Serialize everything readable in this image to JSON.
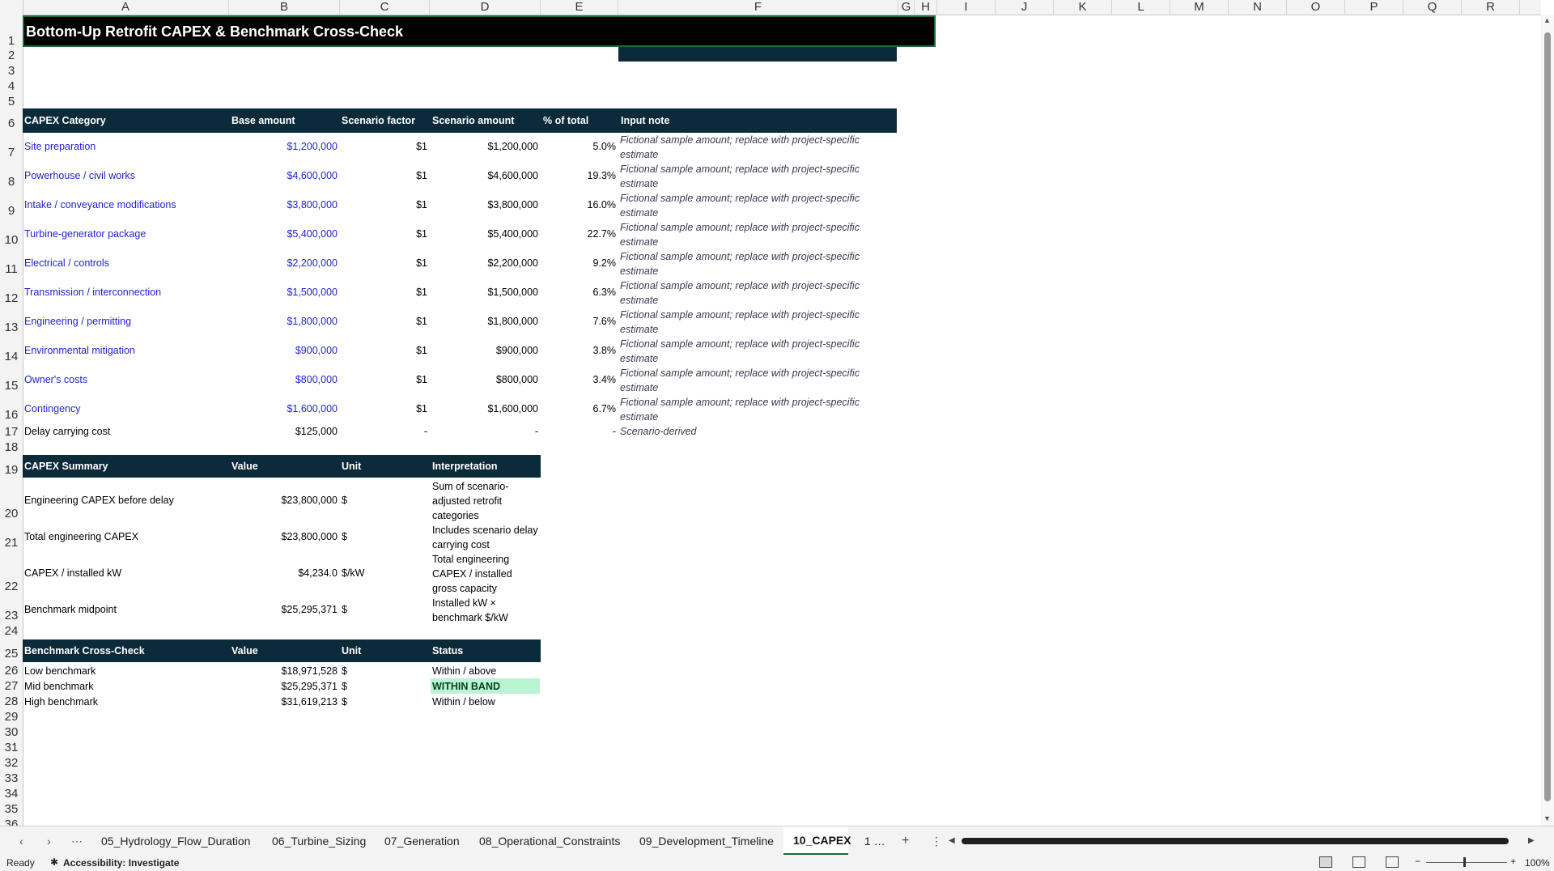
{
  "columns": [
    "A",
    "B",
    "C",
    "D",
    "E",
    "F",
    "G",
    "H",
    "I",
    "J",
    "K",
    "L",
    "M",
    "N",
    "O",
    "P",
    "Q",
    "R"
  ],
  "rows": [
    "1",
    "2",
    "3",
    "4",
    "5",
    "6",
    "7",
    "8",
    "9",
    "10",
    "11",
    "12",
    "13",
    "14",
    "15",
    "16",
    "17",
    "18",
    "19",
    "20",
    "21",
    "22",
    "23",
    "24",
    "25",
    "26",
    "27",
    "28",
    "29",
    "30",
    "31",
    "32",
    "33",
    "34",
    "35",
    "36"
  ],
  "title": "Bottom-Up Retrofit CAPEX & Benchmark Cross-Check",
  "capex_headers": [
    "CAPEX Category",
    "Base amount",
    "Scenario factor",
    "Scenario amount",
    "% of total",
    "Input note"
  ],
  "capex_rows": [
    {
      "cat": "Site preparation",
      "base": "$1,200,000",
      "factor": "$1",
      "amount": "$1,200,000",
      "pct": "5.0%",
      "note": "Fictional sample amount; replace with project-specific estimate"
    },
    {
      "cat": "Powerhouse / civil works",
      "base": "$4,600,000",
      "factor": "$1",
      "amount": "$4,600,000",
      "pct": "19.3%",
      "note": "Fictional sample amount; replace with project-specific estimate"
    },
    {
      "cat": "Intake / conveyance modifications",
      "base": "$3,800,000",
      "factor": "$1",
      "amount": "$3,800,000",
      "pct": "16.0%",
      "note": "Fictional sample amount; replace with project-specific estimate"
    },
    {
      "cat": "Turbine-generator package",
      "base": "$5,400,000",
      "factor": "$1",
      "amount": "$5,400,000",
      "pct": "22.7%",
      "note": "Fictional sample amount; replace with project-specific estimate"
    },
    {
      "cat": "Electrical / controls",
      "base": "$2,200,000",
      "factor": "$1",
      "amount": "$2,200,000",
      "pct": "9.2%",
      "note": "Fictional sample amount; replace with project-specific estimate"
    },
    {
      "cat": "Transmission / interconnection",
      "base": "$1,500,000",
      "factor": "$1",
      "amount": "$1,500,000",
      "pct": "6.3%",
      "note": "Fictional sample amount; replace with project-specific estimate"
    },
    {
      "cat": "Engineering / permitting",
      "base": "$1,800,000",
      "factor": "$1",
      "amount": "$1,800,000",
      "pct": "7.6%",
      "note": "Fictional sample amount; replace with project-specific estimate"
    },
    {
      "cat": "Environmental mitigation",
      "base": "$900,000",
      "factor": "$1",
      "amount": "$900,000",
      "pct": "3.8%",
      "note": "Fictional sample amount; replace with project-specific estimate"
    },
    {
      "cat": "Owner's costs",
      "base": "$800,000",
      "factor": "$1",
      "amount": "$800,000",
      "pct": "3.4%",
      "note": "Fictional sample amount; replace with project-specific estimate"
    },
    {
      "cat": "Contingency",
      "base": "$1,600,000",
      "factor": "$1",
      "amount": "$1,600,000",
      "pct": "6.7%",
      "note": "Fictional sample amount; replace with project-specific estimate"
    }
  ],
  "delay_row": {
    "cat": "Delay carrying cost",
    "base": "$125,000",
    "factor": "-",
    "amount": "-",
    "pct": "-",
    "note": "Scenario-derived"
  },
  "summary_headers": [
    "CAPEX Summary",
    "Value",
    "Unit",
    "Interpretation"
  ],
  "summary_rows": [
    {
      "label": "Engineering CAPEX before delay",
      "value": "$23,800,000",
      "unit": "$",
      "interp": "Sum of scenario-adjusted retrofit categories"
    },
    {
      "label": "Total engineering CAPEX",
      "value": "$23,800,000",
      "unit": "$",
      "interp": "Includes scenario delay carrying cost"
    },
    {
      "label": "CAPEX / installed kW",
      "value": "$4,234.0",
      "unit": "$/kW",
      "interp": "Total engineering CAPEX / installed gross capacity"
    },
    {
      "label": "Benchmark midpoint",
      "value": "$25,295,371",
      "unit": "$",
      "interp": "Installed kW × benchmark $/kW"
    }
  ],
  "bench_headers": [
    "Benchmark Cross-Check",
    "Value",
    "Unit",
    "Status"
  ],
  "bench_rows": [
    {
      "label": "Low benchmark",
      "value": "$18,971,528",
      "unit": "$",
      "status": "Within / above"
    },
    {
      "label": "Mid benchmark",
      "value": "$25,295,371",
      "unit": "$",
      "status": "WITHIN BAND"
    },
    {
      "label": "High benchmark",
      "value": "$31,619,213",
      "unit": "$",
      "status": "Within / below"
    }
  ],
  "tabs": [
    "05_Hydrology_Flow_Duration",
    "06_Turbine_Sizing",
    "07_Generation",
    "08_Operational_Constraints",
    "09_Development_Timeline",
    "10_CAPEX"
  ],
  "tab_more": "1 …",
  "status": {
    "ready": "Ready",
    "accessibility": "Accessibility: Investigate",
    "zoom": "100%"
  },
  "colors": {
    "header_band": "#0c2b3a",
    "input_blue": "#1f1fd6",
    "within_band": "#b9f5d3"
  }
}
